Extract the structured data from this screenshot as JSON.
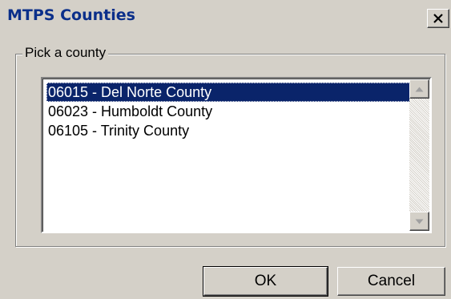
{
  "window": {
    "title": "MTPS Counties",
    "close_label": "×"
  },
  "group": {
    "label": "Pick a county"
  },
  "list": {
    "items": [
      {
        "label": "06015 - Del Norte County",
        "selected": true
      },
      {
        "label": "06023 - Humboldt County",
        "selected": false
      },
      {
        "label": "06105 - Trinity County",
        "selected": false
      }
    ]
  },
  "buttons": {
    "ok_label": "OK",
    "cancel_label": "Cancel"
  },
  "colors": {
    "title_text": "#0b2f8a",
    "selection_bg": "#0a246a",
    "face": "#d4d0c8"
  },
  "icons": {
    "close": "close-icon",
    "scroll_up": "arrow-up-icon",
    "scroll_down": "arrow-down-icon"
  }
}
